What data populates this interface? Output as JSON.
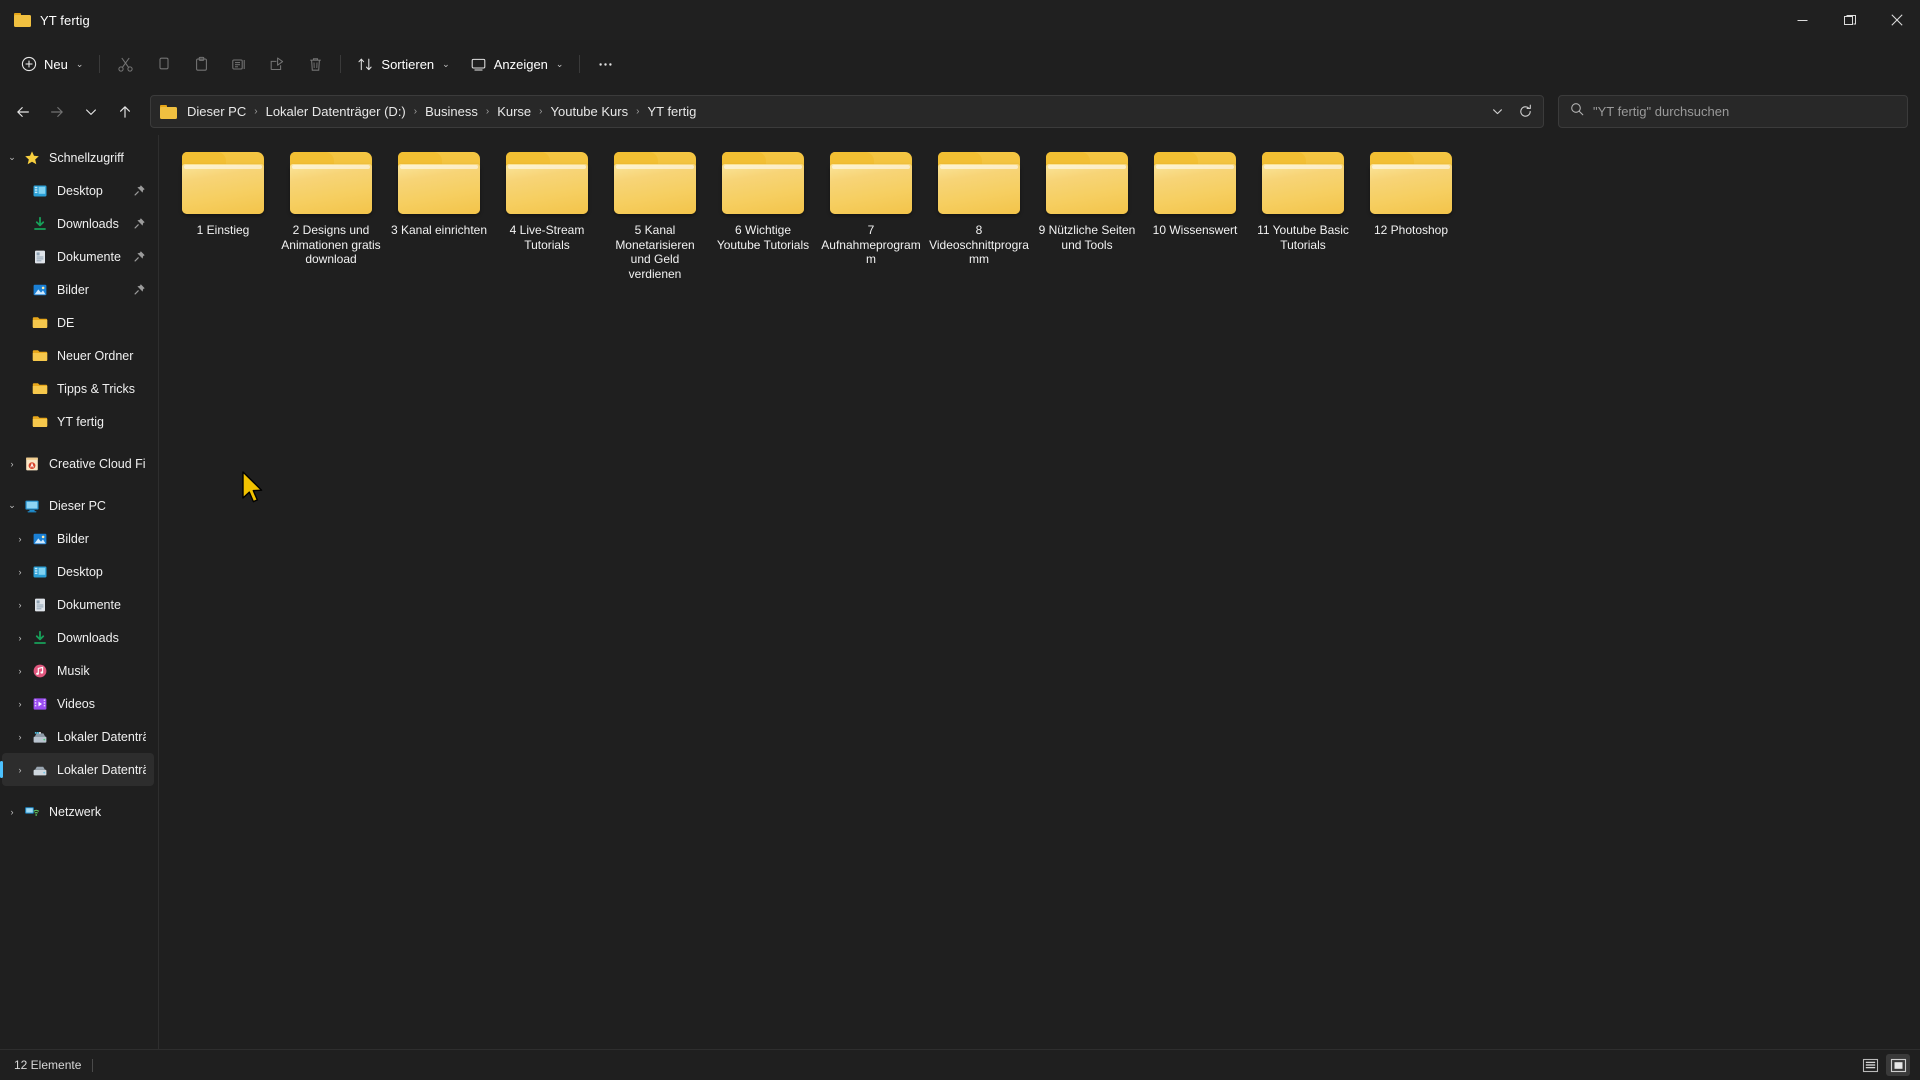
{
  "window": {
    "title": "YT fertig",
    "folder_icon": "folder-icon",
    "controls": {
      "minimize": "minimize-icon",
      "restore": "restore-icon",
      "close": "close-icon"
    }
  },
  "toolbar": {
    "new_label": "Neu",
    "new_icon": "plus-circle-icon",
    "cut_icon": "scissors-icon",
    "copy_icon": "copy-icon",
    "paste_icon": "paste-icon",
    "rename_icon": "rename-icon",
    "share_icon": "share-icon",
    "delete_icon": "trash-icon",
    "sort_label": "Sortieren",
    "sort_icon": "sort-arrows-icon",
    "view_label": "Anzeigen",
    "view_icon": "monitor-icon",
    "more_label": "…",
    "more_icon": "ellipsis-icon"
  },
  "nav": {
    "back_icon": "arrow-left-icon",
    "forward_icon": "arrow-right-icon",
    "recent_icon": "chevron-down-icon",
    "up_icon": "arrow-up-icon",
    "refresh_icon": "refresh-icon",
    "dropdown_icon": "chevron-down-icon"
  },
  "breadcrumb": {
    "icon": "folder-icon",
    "items": [
      "Dieser PC",
      "Lokaler Datenträger (D:)",
      "Business",
      "Kurse",
      "Youtube Kurs",
      "YT fertig"
    ],
    "separator": "›"
  },
  "search": {
    "icon": "search-icon",
    "placeholder": "\"YT fertig\" durchsuchen",
    "value": ""
  },
  "sidebar": {
    "groups": [
      {
        "label": "Schnellzugriff",
        "icon": "star-icon",
        "expanded": true,
        "level": 1,
        "chevron": "⌄",
        "pinned": false,
        "selected": false
      },
      {
        "label": "Desktop",
        "icon": "desktop-icon",
        "level": 2,
        "chevron": "",
        "pinned": true,
        "selected": false
      },
      {
        "label": "Downloads",
        "icon": "download-icon",
        "level": 2,
        "chevron": "",
        "pinned": true,
        "selected": false
      },
      {
        "label": "Dokumente",
        "icon": "document-icon",
        "level": 2,
        "chevron": "",
        "pinned": true,
        "selected": false
      },
      {
        "label": "Bilder",
        "icon": "pictures-icon",
        "level": 2,
        "chevron": "",
        "pinned": true,
        "selected": false
      },
      {
        "label": "DE",
        "icon": "folder-icon",
        "level": 2,
        "chevron": "",
        "pinned": false,
        "selected": false
      },
      {
        "label": "Neuer Ordner",
        "icon": "folder-icon",
        "level": 2,
        "chevron": "",
        "pinned": false,
        "selected": false
      },
      {
        "label": "Tipps & Tricks",
        "icon": "folder-icon",
        "level": 2,
        "chevron": "",
        "pinned": false,
        "selected": false
      },
      {
        "label": "YT fertig",
        "icon": "folder-icon",
        "level": 2,
        "chevron": "",
        "pinned": false,
        "selected": false
      },
      {
        "label": "Creative Cloud Files",
        "icon": "creative-cloud-icon",
        "level": 1,
        "chevron": "›",
        "pinned": false,
        "selected": false
      },
      {
        "label": "Dieser PC",
        "icon": "pc-icon",
        "level": 1,
        "chevron": "⌄",
        "pinned": false,
        "selected": false
      },
      {
        "label": "Bilder",
        "icon": "pictures-icon",
        "level": 2,
        "chevron": "›",
        "pinned": false,
        "selected": false
      },
      {
        "label": "Desktop",
        "icon": "desktop-icon",
        "level": 2,
        "chevron": "›",
        "pinned": false,
        "selected": false
      },
      {
        "label": "Dokumente",
        "icon": "document-icon",
        "level": 2,
        "chevron": "›",
        "pinned": false,
        "selected": false
      },
      {
        "label": "Downloads",
        "icon": "download-icon",
        "level": 2,
        "chevron": "›",
        "pinned": false,
        "selected": false
      },
      {
        "label": "Musik",
        "icon": "music-icon",
        "level": 2,
        "chevron": "›",
        "pinned": false,
        "selected": false
      },
      {
        "label": "Videos",
        "icon": "video-icon",
        "level": 2,
        "chevron": "›",
        "pinned": false,
        "selected": false
      },
      {
        "label": "Lokaler Datenträge",
        "icon": "system-drive-icon",
        "level": 2,
        "chevron": "›",
        "pinned": false,
        "selected": false
      },
      {
        "label": "Lokaler Datenträge",
        "icon": "drive-icon",
        "level": 2,
        "chevron": "›",
        "pinned": false,
        "selected": true
      },
      {
        "label": "Netzwerk",
        "icon": "network-icon",
        "level": 1,
        "chevron": "›",
        "pinned": false,
        "selected": false
      }
    ]
  },
  "files": {
    "items": [
      {
        "name": "1 Einstieg",
        "icon": "folder-icon"
      },
      {
        "name": "2 Designs und Animationen gratis download",
        "icon": "folder-icon"
      },
      {
        "name": "3 Kanal einrichten",
        "icon": "folder-icon"
      },
      {
        "name": "4 Live-Stream Tutorials",
        "icon": "folder-icon"
      },
      {
        "name": "5 Kanal Monetarisieren und Geld verdienen",
        "icon": "folder-icon"
      },
      {
        "name": "6 Wichtige Youtube Tutorials",
        "icon": "folder-icon"
      },
      {
        "name": "7 Aufnahmeprogramm",
        "icon": "folder-icon"
      },
      {
        "name": "8 Videoschnittprogramm",
        "icon": "folder-icon"
      },
      {
        "name": "9 Nützliche Seiten und Tools",
        "icon": "folder-icon"
      },
      {
        "name": "10 Wissenswert",
        "icon": "folder-icon"
      },
      {
        "name": "11 Youtube Basic Tutorials",
        "icon": "folder-icon"
      },
      {
        "name": "12 Photoshop",
        "icon": "folder-icon"
      }
    ]
  },
  "statusbar": {
    "item_count": "12 Elemente",
    "list_view_icon": "list-view-icon",
    "tiles_view_icon": "large-icons-view-icon",
    "active_view": "large-icons-view-icon"
  },
  "colors": {
    "window_bg": "#1f1f1f",
    "titlebar_bg": "#202020",
    "folder_yellow": "#f5c643",
    "accent": "#4cc2ff",
    "cursor": "#f5c518"
  }
}
